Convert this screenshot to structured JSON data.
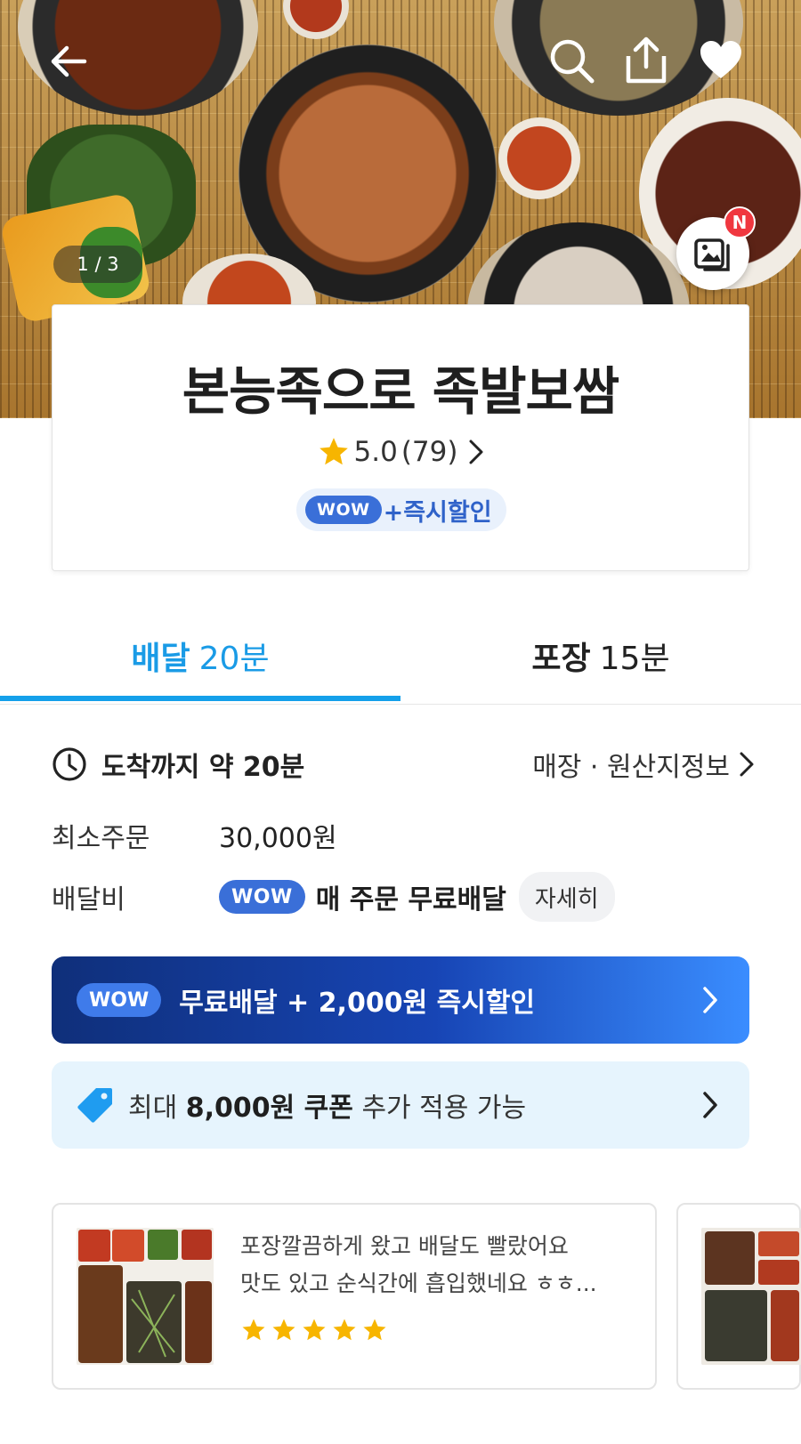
{
  "hero": {
    "photo_counter": "1 / 3",
    "gallery_badge": "N",
    "icons": [
      "back-arrow-icon",
      "search-icon",
      "share-icon",
      "heart-icon",
      "gallery-icon"
    ]
  },
  "store": {
    "name": "본능족으로 족발보쌈",
    "rating": "5.0",
    "review_count": "(79)",
    "wow_tag": "WOW",
    "promo": "+즉시할인"
  },
  "tabs": [
    {
      "label": "배달",
      "time": "20분",
      "active": true
    },
    {
      "label": "포장",
      "time": "15분",
      "active": false
    }
  ],
  "info": {
    "eta": "도착까지 약 20분",
    "store_info_link": "매장 · 원산지정보",
    "min_order_label": "최소주문",
    "min_order_value": "30,000원",
    "delivery_fee_label": "배달비",
    "delivery_fee_wow": "WOW",
    "delivery_fee_value": "매 주문 무료배달",
    "detail_button": "자세히"
  },
  "wow_banner": {
    "tag": "WOW",
    "text": "무료배달 + 2,000원 즉시할인"
  },
  "coupon_banner": {
    "prefix": "최대",
    "amount": "8,000원 쿠폰",
    "suffix": "추가 적용 가능"
  },
  "reviews": [
    {
      "line1": "포장깔끔하게 왔고 배달도 빨랐어요",
      "line2": "맛도 있고 순식간에 흡입했네요 ㅎㅎ...",
      "stars": 5
    }
  ],
  "colors": {
    "accent_blue": "#14a0ea",
    "wow_blue": "#3a6fd8",
    "star_yellow": "#f7b500",
    "badge_red": "#f0373f"
  }
}
